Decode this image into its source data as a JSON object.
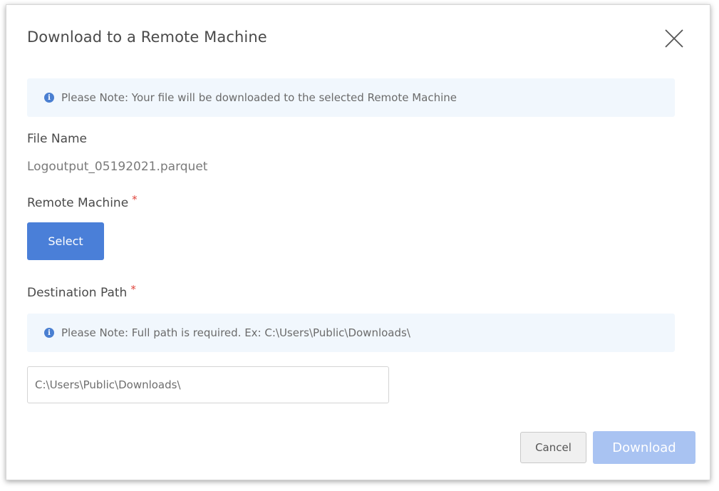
{
  "dialog": {
    "title": "Download to a Remote Machine",
    "close_icon": "close-icon",
    "note_top": {
      "icon": "info-icon",
      "icon_glyph": "i",
      "text": "Please Note: Your file will be downloaded to the selected Remote Machine"
    },
    "file_name": {
      "label": "File Name",
      "value": "Logoutput_05192021.parquet"
    },
    "remote_machine": {
      "label": "Remote Machine",
      "required_mark": "*",
      "select_label": "Select"
    },
    "destination_path": {
      "label": "Destination Path",
      "required_mark": "*",
      "note": {
        "icon": "info-icon",
        "icon_glyph": "i",
        "text": "Please Note: Full path is required. Ex: C:\\Users\\Public\\Downloads\\"
      },
      "input_value": "C:\\Users\\Public\\Downloads\\"
    },
    "footer": {
      "cancel_label": "Cancel",
      "download_label": "Download",
      "download_enabled": false
    }
  },
  "colors": {
    "primary": "#4a7fd8",
    "primary_disabled": "#a9c3f2",
    "note_background": "#f1f7fd",
    "required": "#e0453c"
  }
}
